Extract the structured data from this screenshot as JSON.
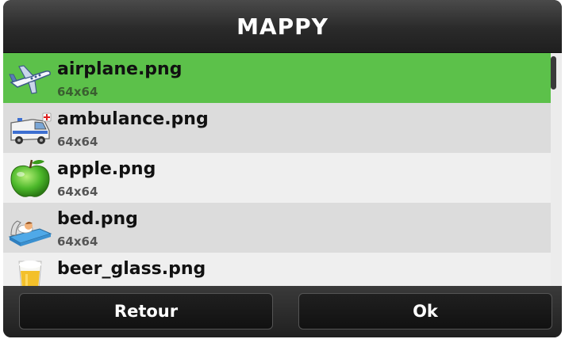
{
  "header": {
    "title": "MAPPY"
  },
  "list": {
    "items": [
      {
        "name": "airplane.png",
        "size": "64x64",
        "icon": "airplane-icon",
        "selected": true
      },
      {
        "name": "ambulance.png",
        "size": "64x64",
        "icon": "ambulance-icon",
        "selected": false
      },
      {
        "name": "apple.png",
        "size": "64x64",
        "icon": "apple-icon",
        "selected": false
      },
      {
        "name": "bed.png",
        "size": "64x64",
        "icon": "bed-icon",
        "selected": false
      },
      {
        "name": "beer_glass.png",
        "size": "",
        "icon": "beer-glass-icon",
        "selected": false
      }
    ]
  },
  "footer": {
    "back_label": "Retour",
    "ok_label": "Ok"
  },
  "colors": {
    "selected": "#5cc14a",
    "header": "#2a2a2a",
    "row_alt": "#dcdcdc",
    "row": "#efefef"
  }
}
